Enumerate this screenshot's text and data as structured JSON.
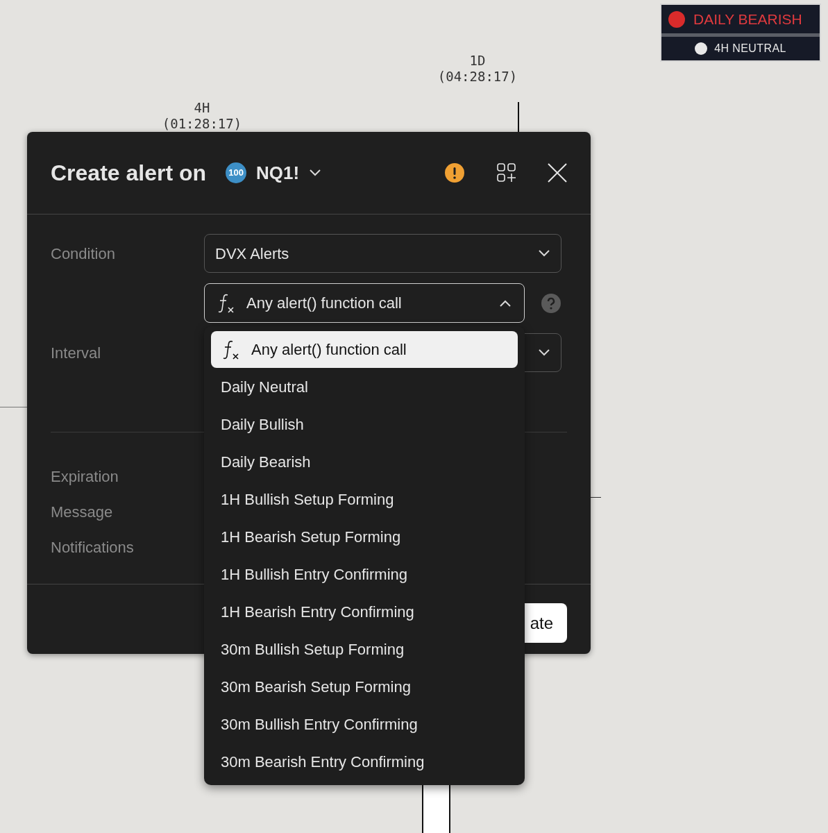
{
  "chart": {
    "labels": [
      {
        "timeframe": "1D",
        "countdown": "(04:28:17)"
      },
      {
        "timeframe": "4H",
        "countdown": "(01:28:17)"
      }
    ]
  },
  "legend": [
    {
      "label": "DAILY BEARISH",
      "color": "#d92b2b"
    },
    {
      "label": "4H NEUTRAL",
      "color": "#e8e8e8"
    }
  ],
  "dialog": {
    "title": "Create alert on",
    "symbol_badge": "100",
    "symbol": "NQ1!",
    "fields": [
      {
        "label": "Condition",
        "value": "DVX Alerts"
      },
      {
        "label": "Interval"
      },
      {
        "label": "Expiration"
      },
      {
        "label": "Message"
      },
      {
        "label": "Notifications"
      }
    ],
    "condition_select": {
      "value": "Any alert() function call",
      "expanded": true
    },
    "create_button": "ate"
  },
  "dropdown": {
    "options": [
      {
        "label": "Any alert() function call",
        "selected": true,
        "kind": "function"
      },
      {
        "label": "Daily Neutral",
        "selected": false
      },
      {
        "label": "Daily Bullish",
        "selected": false
      },
      {
        "label": "Daily Bearish",
        "selected": false
      },
      {
        "label": "1H Bullish Setup Forming",
        "selected": false
      },
      {
        "label": "1H Bearish Setup Forming",
        "selected": false
      },
      {
        "label": "1H Bullish Entry Confirming",
        "selected": false
      },
      {
        "label": "1H Bearish Entry Confirming",
        "selected": false
      },
      {
        "label": "30m Bullish Setup Forming",
        "selected": false
      },
      {
        "label": "30m Bearish Setup Forming",
        "selected": false
      },
      {
        "label": "30m Bullish Entry Confirming",
        "selected": false
      },
      {
        "label": "30m Bearish Entry Confirming",
        "selected": false
      }
    ]
  }
}
